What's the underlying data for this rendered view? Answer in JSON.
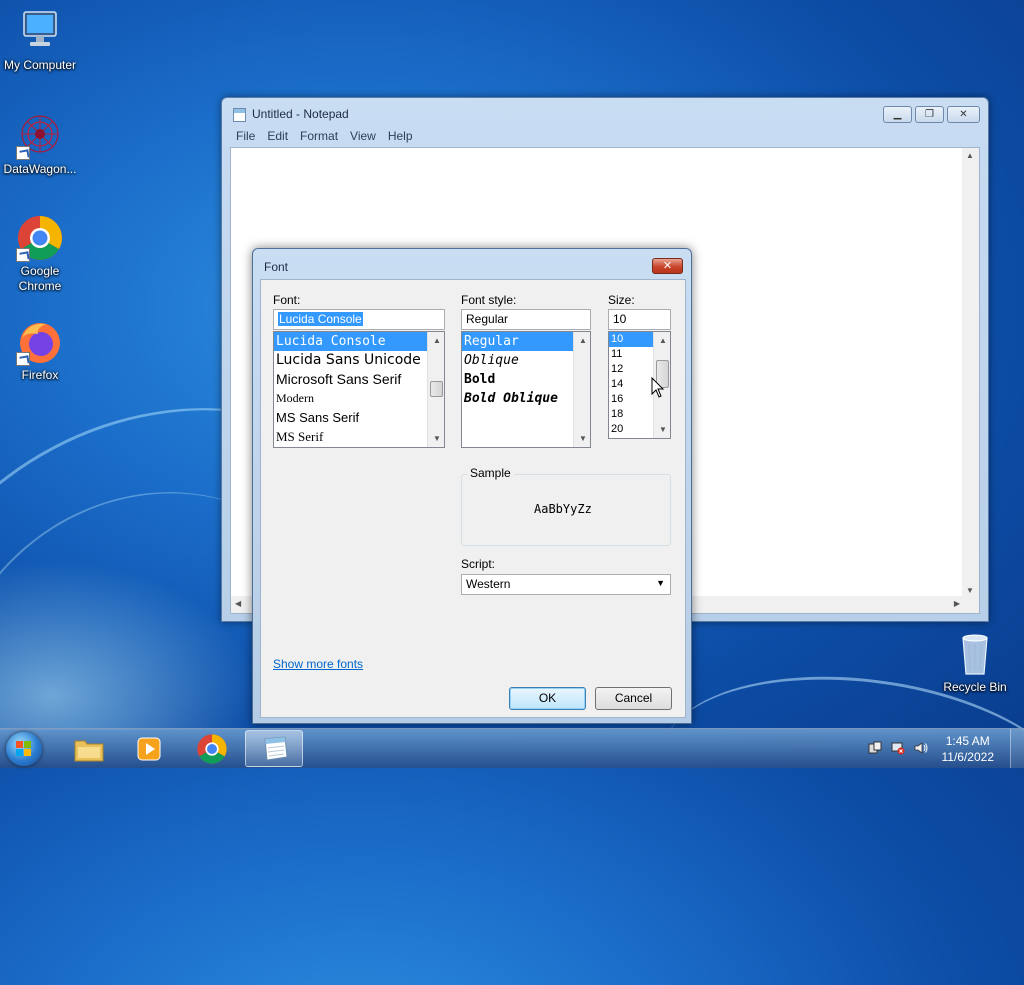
{
  "desktop": {
    "icons": [
      {
        "label": "My Computer"
      },
      {
        "label": "DataWagon..."
      },
      {
        "label": "Google Chrome"
      },
      {
        "label": "Firefox"
      },
      {
        "label": "Recycle Bin"
      }
    ]
  },
  "notepad": {
    "title": "Untitled - Notepad",
    "menu": [
      "File",
      "Edit",
      "Format",
      "View",
      "Help"
    ]
  },
  "font_dialog": {
    "title": "Font",
    "font_label": "Font:",
    "font_value": "Lucida Console",
    "fonts": [
      "Lucida Console",
      "Lucida Sans Unicode",
      "Microsoft Sans Serif",
      "Modern",
      "MS Sans Serif",
      "MS Serif"
    ],
    "style_label": "Font style:",
    "style_value": "Regular",
    "styles": [
      "Regular",
      "Oblique",
      "Bold",
      "Bold Oblique"
    ],
    "size_label": "Size:",
    "size_value": "10",
    "sizes": [
      "10",
      "11",
      "12",
      "14",
      "16",
      "18",
      "20"
    ],
    "sample_label": "Sample",
    "sample_text": "AaBbYyZz",
    "script_label": "Script:",
    "script_value": "Western",
    "show_more_fonts": "Show more fonts",
    "ok_label": "OK",
    "cancel_label": "Cancel"
  },
  "taskbar": {
    "time": "1:45 AM",
    "date": "11/6/2022"
  },
  "colors": {
    "selection": "#3399ff",
    "link": "#0066cc",
    "close_button": "#c8452b"
  }
}
